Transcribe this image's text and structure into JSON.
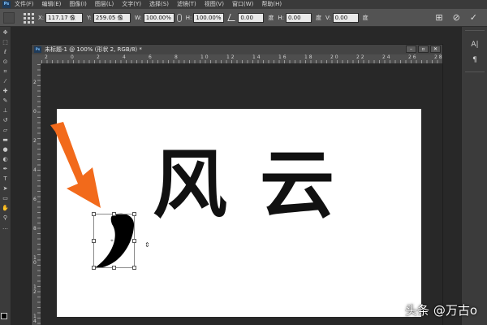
{
  "menubar": {
    "items": [
      "文件(F)",
      "编辑(E)",
      "图像(I)",
      "图层(L)",
      "文字(Y)",
      "选择(S)",
      "滤镜(T)",
      "视图(V)",
      "窗口(W)",
      "帮助(H)"
    ]
  },
  "options": {
    "x_label": "X:",
    "x_value": "117.17 像",
    "y_label": "Y:",
    "y_value": "259.05 像",
    "w_label": "W:",
    "w_value": "100.00%",
    "h_label": "H:",
    "h_value": "100.00%",
    "angle_value": "0.00",
    "angle_unit": "度",
    "hskew_label": "H:",
    "hskew_value": "0.00",
    "hskew_unit": "度",
    "vskew_label": "V:",
    "vskew_value": "0.00",
    "vskew_unit": "度"
  },
  "document": {
    "title": "未标题-1 @ 100% (形状 2, RGB/8) *",
    "ruler_h": [
      "2",
      "0",
      "2",
      "4",
      "6",
      "8",
      "1\n0",
      "1\n2",
      "1\n4",
      "1\n6",
      "1\n8",
      "2\n0",
      "2\n2",
      "2\n4",
      "2\n6",
      "2\n8"
    ],
    "ruler_v": [
      "2",
      "0",
      "2",
      "4",
      "6",
      "8",
      "1\n0",
      "1\n2",
      "1\n4"
    ]
  },
  "canvas": {
    "characters": [
      "风",
      "云"
    ]
  },
  "watermark": "头条 @万古o",
  "colors": {
    "arrow": "#f26a1b",
    "foreground": "#000000"
  }
}
